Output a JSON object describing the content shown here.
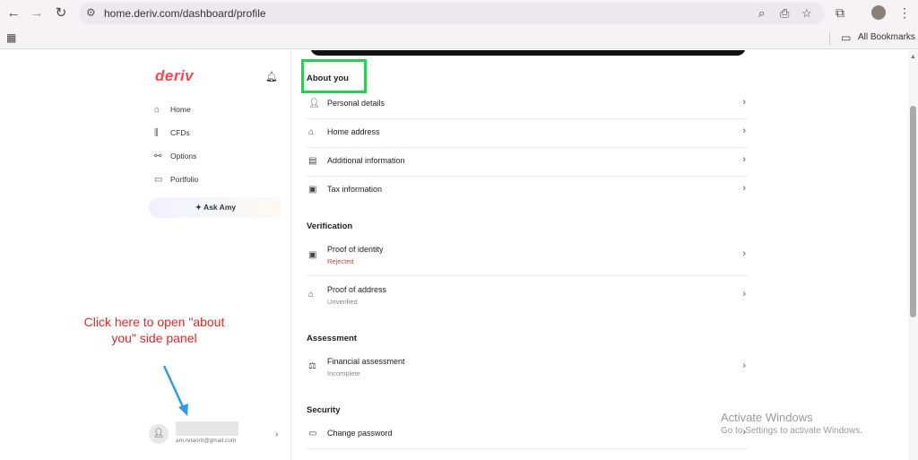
{
  "browser": {
    "url": "home.deriv.com/dashboard/profile",
    "bookmarks_label": "All Bookmarks"
  },
  "sidebar": {
    "logo": "deriv",
    "nav": [
      {
        "label": "Home",
        "icon": "home-icon"
      },
      {
        "label": "CFDs",
        "icon": "chart-icon"
      },
      {
        "label": "Options",
        "icon": "options-icon"
      },
      {
        "label": "Portfolio",
        "icon": "portfolio-icon"
      }
    ],
    "ask_amy": "Ask Amy",
    "user_email": "am.retaorit@gmail.com"
  },
  "annotation": {
    "text": "Click here to open \"about you\" side panel"
  },
  "profile": {
    "sections": [
      {
        "title": "About you",
        "items": [
          {
            "label": "Personal details",
            "icon": "user-icon"
          },
          {
            "label": "Home address",
            "icon": "home-icon"
          },
          {
            "label": "Additional information",
            "icon": "document-icon"
          },
          {
            "label": "Tax information",
            "icon": "tax-icon"
          }
        ]
      },
      {
        "title": "Verification",
        "items": [
          {
            "label": "Proof of identity",
            "status": "Rejected",
            "icon": "id-card-icon"
          },
          {
            "label": "Proof of address",
            "status": "Unverified",
            "icon": "house-check-icon"
          }
        ]
      },
      {
        "title": "Assessment",
        "items": [
          {
            "label": "Financial assessment",
            "status": "Incomplete",
            "icon": "assessment-icon"
          }
        ]
      },
      {
        "title": "Security",
        "items": [
          {
            "label": "Change password",
            "icon": "password-icon"
          }
        ]
      }
    ]
  },
  "watermark": {
    "line1": "Activate Windows",
    "line2": "Go to Settings to activate Windows."
  },
  "colors": {
    "brand": "#ff444f",
    "highlight": "#2ecc55",
    "annotation": "#e32626",
    "rejected": "#e53935"
  }
}
